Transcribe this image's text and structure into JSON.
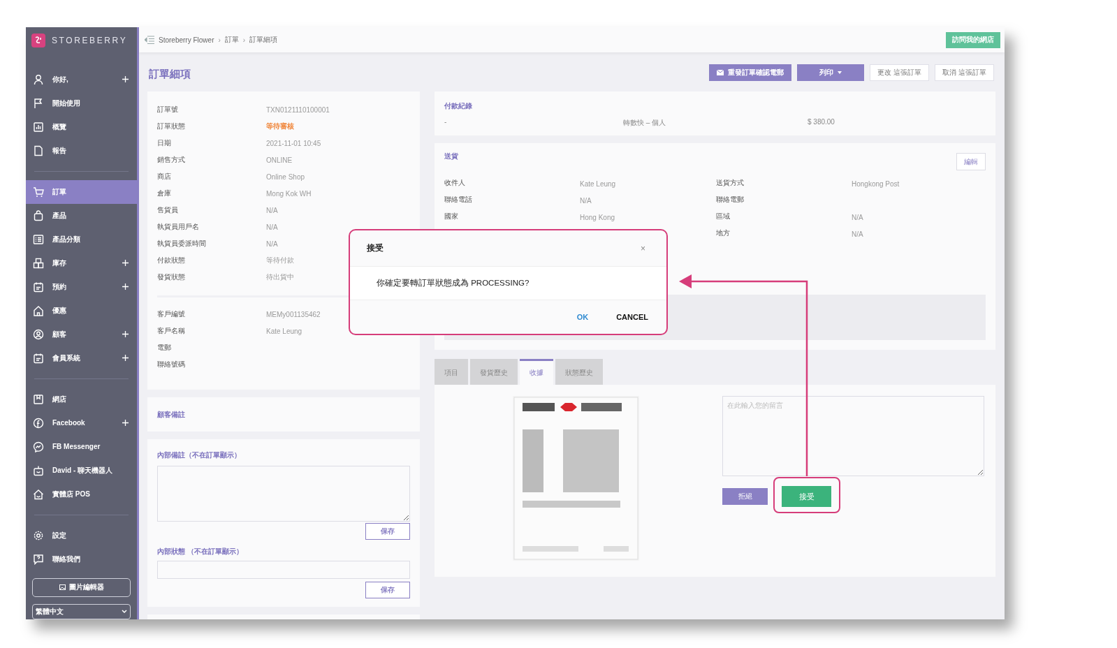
{
  "sidebar": {
    "brand": "STOREBERRY",
    "groups": [
      [
        {
          "label": "你好,",
          "expandable": true,
          "selected": false
        },
        {
          "label": "開始使用",
          "expandable": false,
          "selected": false
        },
        {
          "label": "概覽",
          "expandable": false,
          "selected": false
        },
        {
          "label": "報告",
          "expandable": false,
          "selected": false
        }
      ],
      [
        {
          "label": "訂單",
          "expandable": false,
          "selected": true
        },
        {
          "label": "產品",
          "expandable": false,
          "selected": false
        },
        {
          "label": "產品分類",
          "expandable": false,
          "selected": false
        },
        {
          "label": "庫存",
          "expandable": true,
          "selected": false
        },
        {
          "label": "預約",
          "expandable": true,
          "selected": false
        },
        {
          "label": "優惠",
          "expandable": false,
          "selected": false
        },
        {
          "label": "顧客",
          "expandable": true,
          "selected": false
        },
        {
          "label": "會員系統",
          "expandable": true,
          "selected": false
        }
      ],
      [
        {
          "label": "網店",
          "expandable": false,
          "selected": false
        },
        {
          "label": "Facebook",
          "expandable": true,
          "selected": false
        },
        {
          "label": "FB Messenger",
          "expandable": false,
          "selected": false
        },
        {
          "label": "David - 聊天機器人",
          "expandable": false,
          "selected": false
        },
        {
          "label": "實體店 POS",
          "expandable": false,
          "selected": false
        }
      ],
      [
        {
          "label": "設定",
          "expandable": false,
          "selected": false
        },
        {
          "label": "聯絡我們",
          "expandable": false,
          "selected": false
        }
      ]
    ],
    "image_editor_button": "圖片編輯器",
    "language_select": "繁體中文"
  },
  "topbar": {
    "breadcrumb": [
      "Storeberry Flower",
      "訂單",
      "訂單細項"
    ],
    "separator": "›",
    "visit_store_button": "訪問我的網店"
  },
  "page_title": "訂單細項",
  "actions": [
    {
      "label": "重發訂單確認電郵",
      "kind": "mail"
    },
    {
      "label": "列印",
      "kind": "dropdown"
    },
    {
      "label": "更改 這張訂單",
      "kind": "outline"
    },
    {
      "label": "取消 這張訂單",
      "kind": "outline"
    }
  ],
  "order_details": [
    [
      {
        "label": "訂單號",
        "value": "TXN0121110100001"
      },
      {
        "label": "訂單狀態",
        "value": "等待審核",
        "color": "#f0883e"
      },
      {
        "label": "日期",
        "value": "2021-11-01 10:45"
      },
      {
        "label": "銷售方式",
        "value": "ONLINE"
      },
      {
        "label": "商店",
        "value": "Online Shop"
      },
      {
        "label": "倉庫",
        "value": "Mong Kok WH"
      },
      {
        "label": "售貨員",
        "value": "N/A"
      },
      {
        "label": "執貨員用戶名",
        "value": "N/A"
      },
      {
        "label": "執貨員委派時間",
        "value": "N/A"
      },
      {
        "label": "付款狀態",
        "value": "等待付款"
      },
      {
        "label": "發貨狀態",
        "value": "待出貨中"
      }
    ],
    [
      {
        "label": "客戶編號",
        "value": "MEMy001135462"
      },
      {
        "label": "客戶名稱",
        "value": "Kate Leung"
      },
      {
        "label": "電郵"
      },
      {
        "label": "聯絡號碼"
      }
    ]
  ],
  "customer_notes": {
    "title": "顧客備註"
  },
  "internal": {
    "note_label": "內部備註（不在訂單顯示）",
    "status_label": "內部狀態 （不在訂單顯示）",
    "save_buttons": [
      "保存",
      "保存"
    ]
  },
  "payment": {
    "title": "付款紀錄",
    "row": [
      "-",
      "轉數快 – 個人",
      "$ 380.00"
    ]
  },
  "shipping": {
    "title": "送貨",
    "edit_button": "編輯",
    "rows": [
      {
        "left_label": "收件人",
        "left_value": "Kate Leung",
        "right_label": "送貨方式",
        "right_value": "Hongkong Post"
      },
      {
        "left_label": "聯絡電話",
        "left_value": "N/A",
        "right_label": "聯絡電郵"
      },
      {
        "left_label": "國家",
        "left_value": "Hong Kong",
        "right_label": "區域",
        "right_value": "N/A"
      },
      {
        "right_label": "地方",
        "right_value": "N/A"
      }
    ]
  },
  "tabs": [
    {
      "label": "項目",
      "selected": false
    },
    {
      "label": "發貨歷史",
      "selected": false
    },
    {
      "label": "收據",
      "selected": true
    },
    {
      "label": "狀態歷史",
      "selected": false
    }
  ],
  "receipt": {
    "message_placeholder": "在此輸入您的留言",
    "reject_button": "拒絕",
    "accept_button": "接受"
  },
  "dialog": {
    "title": "接受",
    "close": "×",
    "message": "你確定要轉訂單狀態成為 PROCESSING?",
    "ok": "OK",
    "cancel": "CANCEL"
  }
}
